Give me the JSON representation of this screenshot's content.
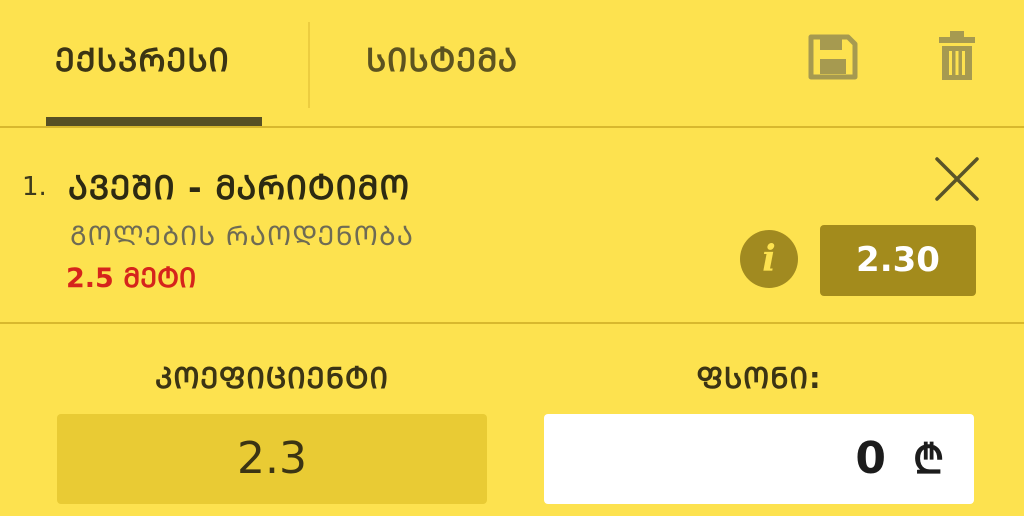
{
  "tabs": {
    "express": "ᲔᲥᲡᲞᲠᲔᲡᲘ",
    "system": "ᲡᲘᲡᲢᲔᲛᲐ"
  },
  "icons": {
    "save": "save-icon",
    "trash": "trash-icon",
    "close": "close-icon",
    "info": "info-icon"
  },
  "bet": {
    "index": "1.",
    "title": "ᲐᲕᲔᲨᲘ - ᲛᲐᲠᲘᲢᲘᲛᲝ",
    "market": "ᲒᲝᲚᲔᲑᲘᲡ ᲠᲐᲝᲓᲔᲜᲝᲑᲐ",
    "selection": "2.5 ᲛᲔᲢᲘ",
    "info_glyph": "i",
    "odds": "2.30"
  },
  "footer": {
    "coefficient_label": "ᲙᲝᲔᲤᲘᲪᲘᲔᲜᲢᲘ",
    "coefficient_value": "2.3",
    "stake_label": "ᲤᲡᲝᲜᲘ:",
    "stake_value": "0",
    "currency": "₾"
  },
  "colors": {
    "background": "#fde24f",
    "accent_dark": "#a38b1c",
    "selection_red": "#d5241c",
    "input_bg": "#ffffff"
  }
}
